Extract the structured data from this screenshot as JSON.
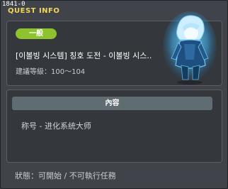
{
  "window": {
    "id_label": "1841-0",
    "title": "QUEST INFO"
  },
  "quest": {
    "category_badge": "一般",
    "name": "[이볼빙 시스템] 칭호 도전 - 이볼빙 시스..",
    "level_label": "建議等級：100～104",
    "portrait_icon": "character-portrait-icon"
  },
  "content": {
    "header": "內容",
    "text": "称号 - 进化系统大师"
  },
  "status": {
    "text": "狀態：可開始 / 不可執行任務"
  },
  "colors": {
    "title": "#f2d65a",
    "badge": "#8ec22e",
    "header_bar": "#5f6d72",
    "window_bg": "#40444a",
    "panel_bg": "#34373c"
  }
}
